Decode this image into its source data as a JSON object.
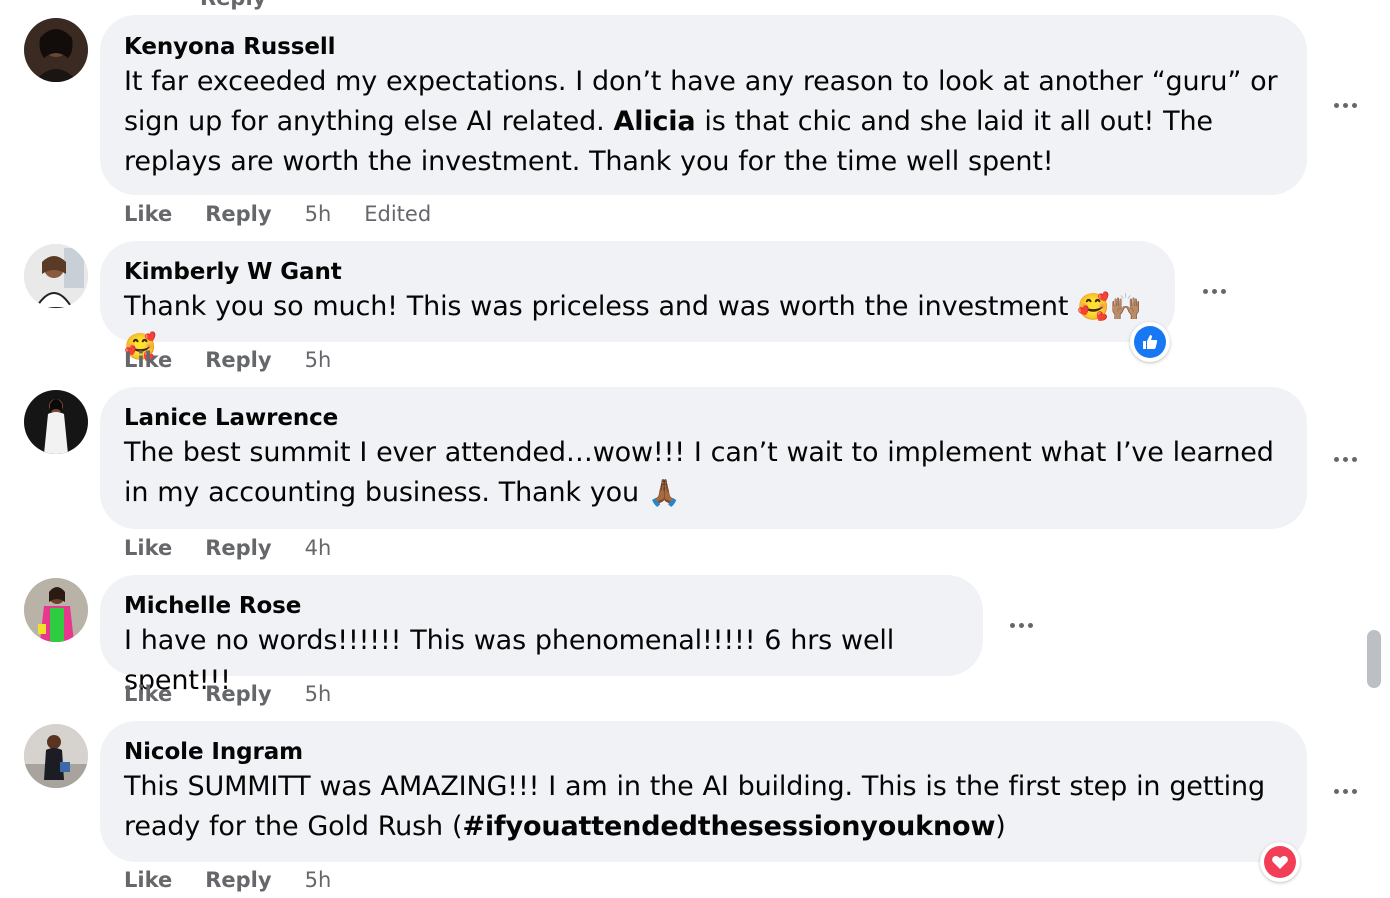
{
  "top_stub": "Reply",
  "actions": {
    "like": "Like",
    "reply": "Reply"
  },
  "comments": [
    {
      "author": "Kenyona Russell",
      "text_parts": [
        "It far exceeded my expectations. I don’t have any reason to look at another “guru” or sign up for anything else AI related. ",
        "Alicia",
        " is that chic and she laid it all out! The replays are worth the investment. Thank you for the time well spent!"
      ],
      "time": "5h",
      "edited": "Edited"
    },
    {
      "author": "Kimberly W Gant",
      "text": "Thank you so much! This was priceless and was worth the investment",
      "emojis": [
        "🥰",
        "🙌🏽",
        "🥰"
      ],
      "time": "5h",
      "reaction": "like",
      "reaction_color": "#1877f2"
    },
    {
      "author": "Lanice Lawrence",
      "text": "The best summit I ever attended…wow!!! I can’t wait to implement what I’ve learned in my accounting business. Thank you",
      "emoji": "🙏🏾",
      "time": "4h"
    },
    {
      "author": "Michelle Rose",
      "text": "I have no words!!!!!! This was phenomenal!!!!! 6 hrs well spent!!!",
      "time": "5h"
    },
    {
      "author": "Nicole Ingram",
      "text_parts": [
        "This SUMMITT was AMAZING!!! I am in the AI building. This is the first step in getting ready for the Gold Rush (",
        "#ifyouattendedthesessionyouknow",
        ")"
      ],
      "time": "5h",
      "reaction": "love",
      "reaction_color": "#f33e58"
    }
  ],
  "colors": {
    "bubble": "#f0f2f5",
    "meta": "#65676b",
    "text": "#050505"
  }
}
